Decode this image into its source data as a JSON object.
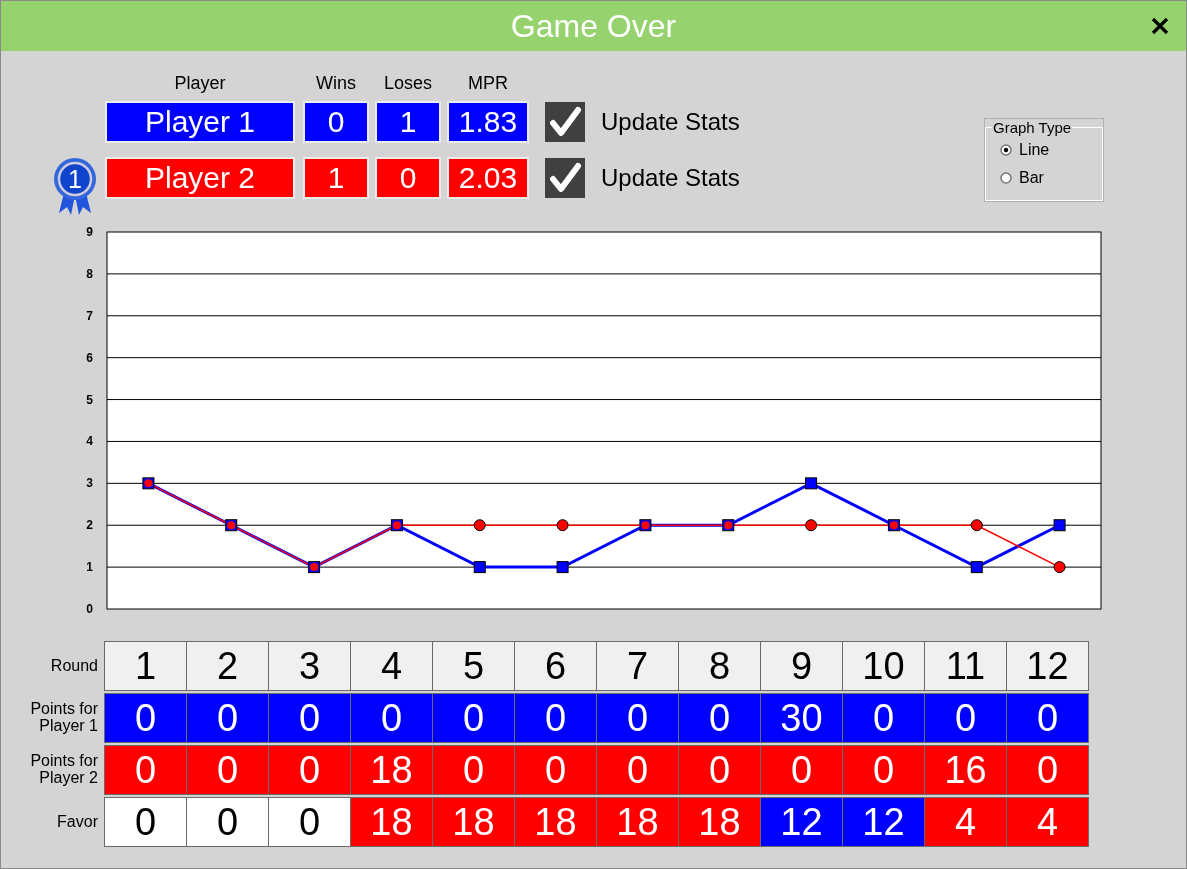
{
  "window": {
    "title": "Game Over"
  },
  "player_columns": [
    "Player",
    "Wins",
    "Loses",
    "MPR"
  ],
  "players": [
    {
      "name": "Player 1",
      "wins": "0",
      "loses": "1",
      "mpr": "1.83",
      "color": "#0000ff",
      "update_stats": {
        "label": "Update Stats",
        "checked": true
      }
    },
    {
      "name": "Player 2",
      "wins": "1",
      "loses": "0",
      "mpr": "2.03",
      "color": "#ff0000",
      "badge": "1",
      "update_stats": {
        "label": "Update Stats",
        "checked": true
      }
    }
  ],
  "graph_type": {
    "title": "Graph Type",
    "options": [
      {
        "label": "Line",
        "selected": true
      },
      {
        "label": "Bar",
        "selected": false
      }
    ]
  },
  "chart_data": {
    "type": "line",
    "grid": true,
    "ylim": [
      0,
      9
    ],
    "yticks": [
      0,
      1,
      2,
      3,
      4,
      5,
      6,
      7,
      8,
      9
    ],
    "series": [
      {
        "color": "#0000ff",
        "marker": "square",
        "values": [
          3,
          2,
          1,
          2,
          1,
          1,
          2,
          2,
          3,
          2,
          1,
          2
        ]
      },
      {
        "color": "#ff0000",
        "marker": "circle",
        "values": [
          3,
          2,
          1,
          2,
          2,
          2,
          2,
          2,
          2,
          2,
          2,
          1
        ]
      }
    ]
  },
  "table": {
    "rows": [
      {
        "label": "Round",
        "kind": "header",
        "cells": [
          {
            "value": "1"
          },
          {
            "value": "2"
          },
          {
            "value": "3"
          },
          {
            "value": "4"
          },
          {
            "value": "5"
          },
          {
            "value": "6"
          },
          {
            "value": "7"
          },
          {
            "value": "8"
          },
          {
            "value": "9"
          },
          {
            "value": "10"
          },
          {
            "value": "11"
          },
          {
            "value": "12"
          }
        ]
      },
      {
        "label": "Points for Player 1",
        "kind": "points",
        "cells": [
          {
            "value": "0",
            "color": "#0000ff"
          },
          {
            "value": "0",
            "color": "#0000ff"
          },
          {
            "value": "0",
            "color": "#0000ff"
          },
          {
            "value": "0",
            "color": "#0000ff"
          },
          {
            "value": "0",
            "color": "#0000ff"
          },
          {
            "value": "0",
            "color": "#0000ff"
          },
          {
            "value": "0",
            "color": "#0000ff"
          },
          {
            "value": "0",
            "color": "#0000ff"
          },
          {
            "value": "30",
            "color": "#0000ff"
          },
          {
            "value": "0",
            "color": "#0000ff"
          },
          {
            "value": "0",
            "color": "#0000ff"
          },
          {
            "value": "0",
            "color": "#0000ff"
          }
        ]
      },
      {
        "label": "Points for Player 2",
        "kind": "points",
        "cells": [
          {
            "value": "0",
            "color": "#ff0000"
          },
          {
            "value": "0",
            "color": "#ff0000"
          },
          {
            "value": "0",
            "color": "#ff0000"
          },
          {
            "value": "18",
            "color": "#ff0000"
          },
          {
            "value": "0",
            "color": "#ff0000"
          },
          {
            "value": "0",
            "color": "#ff0000"
          },
          {
            "value": "0",
            "color": "#ff0000"
          },
          {
            "value": "0",
            "color": "#ff0000"
          },
          {
            "value": "0",
            "color": "#ff0000"
          },
          {
            "value": "0",
            "color": "#ff0000"
          },
          {
            "value": "16",
            "color": "#ff0000"
          },
          {
            "value": "0",
            "color": "#ff0000"
          }
        ]
      },
      {
        "label": "Favor",
        "kind": "points",
        "cells": [
          {
            "value": "0",
            "color": "#ffffff"
          },
          {
            "value": "0",
            "color": "#ffffff"
          },
          {
            "value": "0",
            "color": "#ffffff"
          },
          {
            "value": "18",
            "color": "#ff0000"
          },
          {
            "value": "18",
            "color": "#ff0000"
          },
          {
            "value": "18",
            "color": "#ff0000"
          },
          {
            "value": "18",
            "color": "#ff0000"
          },
          {
            "value": "18",
            "color": "#ff0000"
          },
          {
            "value": "12",
            "color": "#0000ff"
          },
          {
            "value": "12",
            "color": "#0000ff"
          },
          {
            "value": "4",
            "color": "#ff0000"
          },
          {
            "value": "4",
            "color": "#ff0000"
          }
        ]
      }
    ]
  }
}
